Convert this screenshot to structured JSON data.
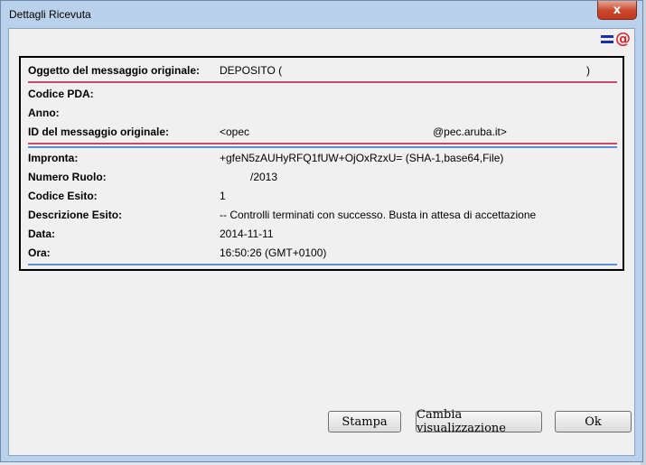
{
  "window": {
    "title": "Dettagli Ricevuta",
    "close_glyph": "x",
    "app_icon": "pec-mail-icon",
    "app_icon_glyph": "@"
  },
  "details": {
    "oggetto": {
      "label": "Oggetto del messaggio originale:",
      "value": "DEPOSITO (",
      "value_end": ")"
    },
    "codice_pda": {
      "label": "Codice PDA:",
      "value": ""
    },
    "anno": {
      "label": "Anno:",
      "value": ""
    },
    "id_messaggio": {
      "label": "ID del messaggio originale:",
      "value": "<opec",
      "value_end": "@pec.aruba.it>"
    },
    "impronta": {
      "label": "Impronta:",
      "value": "+gfeN5zAUHyRFQ1fUW+OjOxRzxU= (SHA-1,base64,File)"
    },
    "numero_ruolo": {
      "label": "Numero Ruolo:",
      "value": "/2013"
    },
    "codice_esito": {
      "label": "Codice Esito:",
      "value": "1"
    },
    "descrizione_esito": {
      "label": "Descrizione Esito:",
      "value": "-- Controlli terminati con successo. Busta in attesa di accettazione"
    },
    "data": {
      "label": "Data:",
      "value": "2014-11-11"
    },
    "ora": {
      "label": "Ora:",
      "value": "16:50:26 (GMT+0100)"
    }
  },
  "buttons": {
    "stampa": "Stampa",
    "cambia": "Cambia visualizzazione",
    "ok": "Ok"
  },
  "colors": {
    "separator_red": "#c84a6a",
    "separator_blue": "#5b8fd6",
    "icon_blue": "#1b2fa6",
    "icon_red": "#e0202a"
  }
}
